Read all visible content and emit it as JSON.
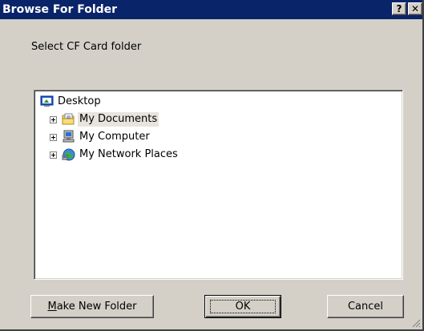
{
  "window": {
    "title": "Browse For Folder",
    "help_label": "?",
    "close_label": "✕"
  },
  "instructions": "Select CF Card folder",
  "tree": {
    "root": {
      "label": "Desktop",
      "icon": "desktop-icon"
    },
    "children": [
      {
        "label": "My Documents",
        "icon": "folder-documents-icon",
        "selected": true
      },
      {
        "label": "My Computer",
        "icon": "computer-icon",
        "selected": false
      },
      {
        "label": "My Network Places",
        "icon": "network-places-icon",
        "selected": false
      }
    ]
  },
  "buttons": {
    "new_folder_mnemonic": "M",
    "new_folder_rest": "ake New Folder",
    "ok": "OK",
    "cancel": "Cancel"
  },
  "colors": {
    "titlebar": "#0a246a",
    "face": "#d4d0c8",
    "selection": "#e6e4dc"
  }
}
